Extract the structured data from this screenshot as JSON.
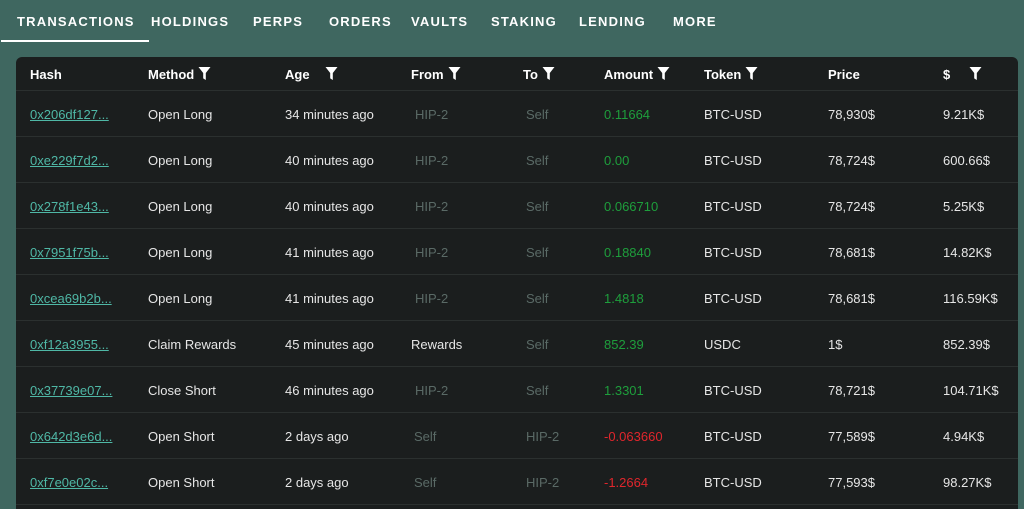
{
  "tabs": [
    {
      "label": "TRANSACTIONS",
      "active": true
    },
    {
      "label": "HOLDINGS"
    },
    {
      "label": "PERPS"
    },
    {
      "label": "ORDERS"
    },
    {
      "label": "VAULTS"
    },
    {
      "label": "STAKING"
    },
    {
      "label": "LENDING"
    },
    {
      "label": "MORE"
    }
  ],
  "columns": [
    "Hash",
    "Method",
    "Age",
    "From",
    "To",
    "Amount",
    "Token",
    "Price",
    "$"
  ],
  "rows": [
    {
      "hash": "0x206df127...",
      "method": "Open Long",
      "age": "34 minutes ago",
      "from": "HIP-2",
      "to": "Self",
      "amount": "0.11664",
      "token": "BTC-USD",
      "price": "78,930$",
      "usd": "9.21K$"
    },
    {
      "hash": "0xe229f7d2...",
      "method": "Open Long",
      "age": "40 minutes ago",
      "from": "HIP-2",
      "to": "Self",
      "amount": "0.00",
      "token": "BTC-USD",
      "price": "78,724$",
      "usd": "600.66$"
    },
    {
      "hash": "0x278f1e43...",
      "method": "Open Long",
      "age": "40 minutes ago",
      "from": "HIP-2",
      "to": "Self",
      "amount": "0.066710",
      "token": "BTC-USD",
      "price": "78,724$",
      "usd": "5.25K$"
    },
    {
      "hash": "0x7951f75b...",
      "method": "Open Long",
      "age": "41 minutes ago",
      "from": "HIP-2",
      "to": "Self",
      "amount": "0.18840",
      "token": "BTC-USD",
      "price": "78,681$",
      "usd": "14.82K$"
    },
    {
      "hash": "0xcea69b2b...",
      "method": "Open Long",
      "age": "41 minutes ago",
      "from": "HIP-2",
      "to": "Self",
      "amount": "1.4818",
      "token": "BTC-USD",
      "price": "78,681$",
      "usd": "116.59K$"
    },
    {
      "hash": "0xf12a3955...",
      "method": "Claim Rewards",
      "age": "45 minutes ago",
      "from": "Rewards",
      "to": "Self",
      "amount": "852.39",
      "token": "USDC",
      "price": "1$",
      "usd": "852.39$"
    },
    {
      "hash": "0x37739e07...",
      "method": "Close Short",
      "age": "46 minutes ago",
      "from": "HIP-2",
      "to": "Self",
      "amount": "1.3301",
      "token": "BTC-USD",
      "price": "78,721$",
      "usd": "104.71K$"
    },
    {
      "hash": "0x642d3e6d...",
      "method": "Open Short",
      "age": "2 days ago",
      "from": "Self",
      "to": "HIP-2",
      "amount": "-0.063660",
      "token": "BTC-USD",
      "price": "77,589$",
      "usd": "4.94K$"
    },
    {
      "hash": "0xf7e0e02c...",
      "method": "Open Short",
      "age": "2 days ago",
      "from": "Self",
      "to": "HIP-2",
      "amount": "-1.2664",
      "token": "BTC-USD",
      "price": "77,593$",
      "usd": "98.27K$"
    }
  ],
  "colors": {
    "tabbar_bg": "#3f6760",
    "panel_bg": "#1b1e1e",
    "link": "#4fb8a6",
    "positive": "#1e9e3c",
    "negative": "#e0262c",
    "dim": "#5a6a66"
  },
  "icons": {
    "filter": "filter-icon"
  }
}
